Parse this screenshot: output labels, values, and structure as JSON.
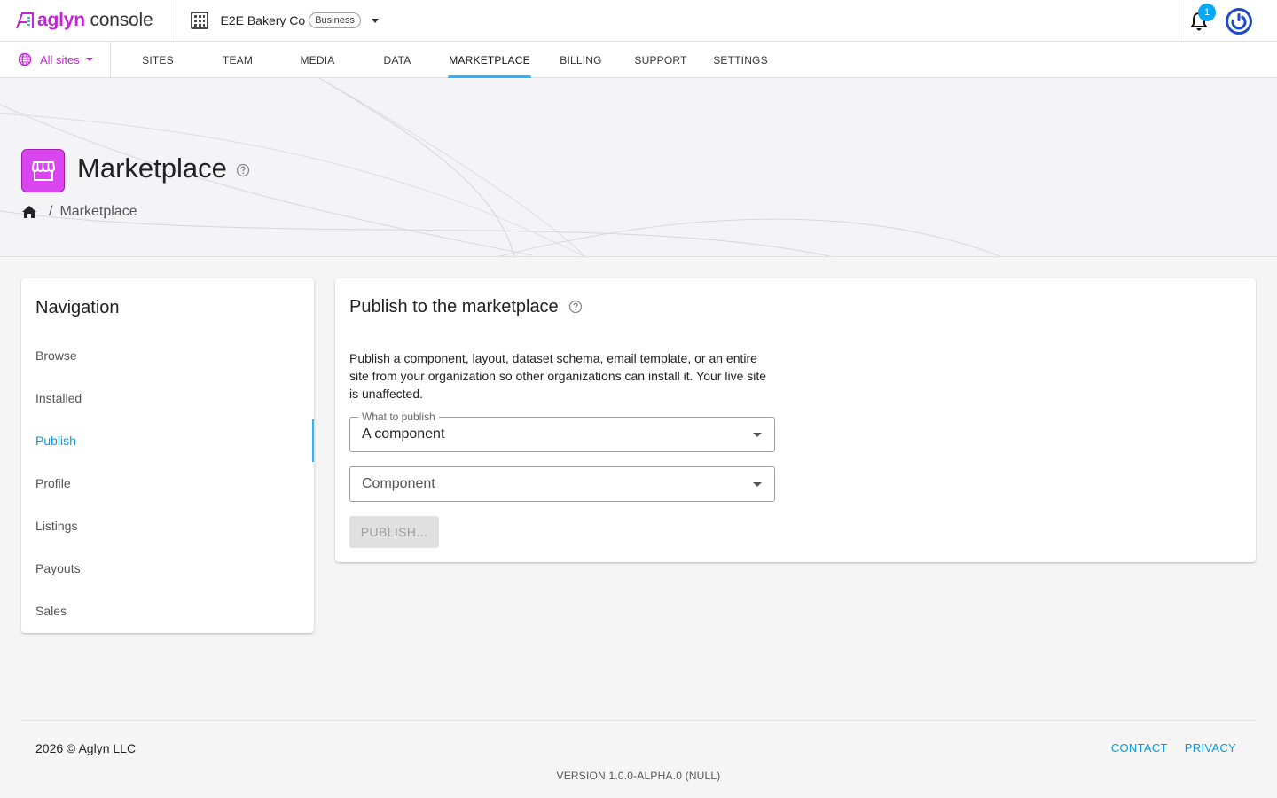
{
  "brand": {
    "name_part1": "aglyn",
    "name_part2": " console",
    "accent_color": "#c026d3"
  },
  "org": {
    "name": "E2E Bakery Co",
    "plan_badge": "Business",
    "icon": "building-icon"
  },
  "header": {
    "notification_count": "1",
    "notification_icon": "bell-icon",
    "account_icon": "power-icon"
  },
  "site_selector": {
    "label": "All sites",
    "icon": "globe-icon"
  },
  "tabs": [
    {
      "label": "SITES"
    },
    {
      "label": "TEAM"
    },
    {
      "label": "MEDIA"
    },
    {
      "label": "DATA"
    },
    {
      "label": "MARKETPLACE",
      "active": true
    },
    {
      "label": "BILLING"
    },
    {
      "label": "SUPPORT"
    },
    {
      "label": "SETTINGS"
    }
  ],
  "page": {
    "title": "Marketplace",
    "icon": "storefront-icon",
    "breadcrumb": "Marketplace"
  },
  "navigation": {
    "title": "Navigation",
    "items": [
      {
        "label": "Browse"
      },
      {
        "label": "Installed"
      },
      {
        "label": "Publish",
        "active": true
      },
      {
        "label": "Profile"
      },
      {
        "label": "Listings"
      },
      {
        "label": "Payouts"
      },
      {
        "label": "Sales"
      }
    ]
  },
  "publish": {
    "title": "Publish to the marketplace",
    "description": "Publish a component, layout, dataset schema, email template, or an entire site from your organization so other organizations can install it. Your live site is unaffected.",
    "what_label": "What to publish",
    "what_value": "A component",
    "component_placeholder": "Component",
    "button_label": "PUBLISH...",
    "button_disabled": true
  },
  "footer": {
    "copyright": "2026 © Aglyn LLC",
    "links": [
      {
        "label": "CONTACT"
      },
      {
        "label": "PRIVACY"
      }
    ],
    "version": "VERSION 1.0.0-ALPHA.0 (NULL)"
  },
  "colors": {
    "link": "#039be5",
    "tab_indicator": "#29b6f6",
    "badge": "#03a9f4"
  }
}
